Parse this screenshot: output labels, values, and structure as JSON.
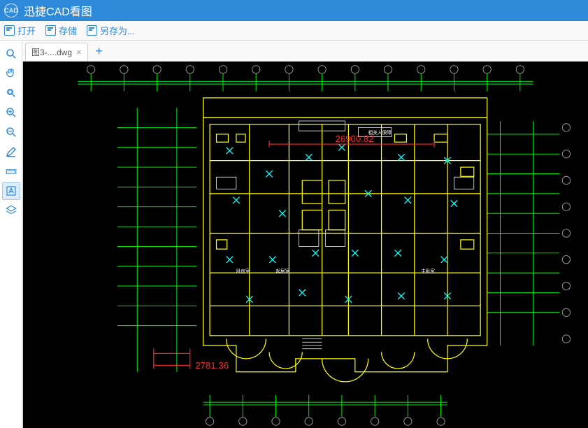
{
  "app": {
    "title": "迅捷CAD看图"
  },
  "menu": {
    "open": "打开",
    "save": "存储",
    "saveAs": "另存为..."
  },
  "tabs": {
    "items": [
      {
        "label": "图3-....dwg"
      }
    ]
  },
  "drawing": {
    "dim1": "26900.82",
    "dim2": "2781.36",
    "roomLabels": [
      "相关人保障",
      "主卧室",
      "卧房室",
      "起居室"
    ]
  },
  "tools": {
    "fit": "zoom-fit",
    "pan": "pan",
    "zoomWindow": "zoom-window",
    "zoomIn": "zoom-in",
    "zoomOut": "zoom-out",
    "draw": "pencil",
    "measure": "ruler",
    "text": "text",
    "layers": "layers"
  }
}
